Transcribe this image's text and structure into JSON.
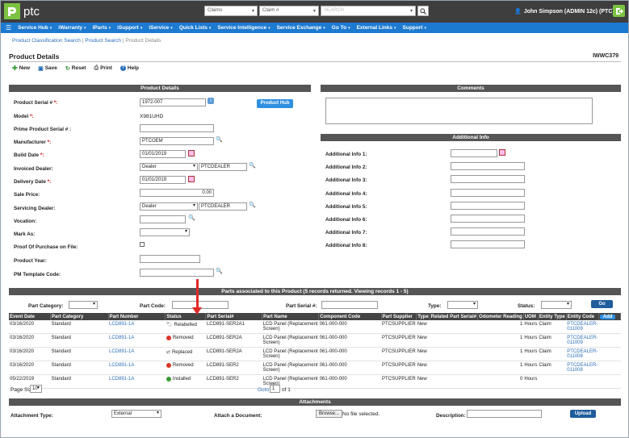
{
  "app": {
    "logo_text": "ptc"
  },
  "search": {
    "type_value": "Claims",
    "field_value": "Claim #",
    "placeholder": "SEARCH"
  },
  "user": {
    "name": "John Simpson (ADMIN 12c) (PTC)"
  },
  "nav": {
    "items": [
      "Service Hub",
      "iWarranty",
      "iParts",
      "iSupport",
      "iService",
      "Quick Lists",
      "Service Intelligence",
      "Service Exchange",
      "Go To",
      "External Links",
      "Support"
    ]
  },
  "breadcrumb": {
    "items": [
      "Product Classification Search",
      "Product Search",
      "Product Details"
    ]
  },
  "page": {
    "title": "Product Details",
    "code": "IWWC379"
  },
  "toolbar": {
    "new": "New",
    "save": "Save",
    "reset": "Reset",
    "print": "Print",
    "help": "Help"
  },
  "product_details": {
    "heading": "Product Details",
    "hub_button": "Product Hub",
    "labels": {
      "serial": "Product Serial # ",
      "model": "Model ",
      "prime_serial": "Prime Product Serial # :",
      "manufacturer": "Manufacturer ",
      "build_date": "Build Date ",
      "invoiced_dealer": "Invoiced Dealer:",
      "delivery_date": "Delivery Date ",
      "sale_price": "Sale Price:",
      "servicing_dealer": "Servicing Dealer:",
      "vocation": "Vocation:",
      "mark_as": "Mark As:",
      "proof_purchase": "Proof Of Purchase on File:",
      "product_year": "Product Year:",
      "pm_template": "PM Template Code:"
    },
    "req_suffix_colon": "*:",
    "req_suffix": "*:",
    "values": {
      "serial": "1972-007",
      "model": "X981UHD",
      "prime_serial": "",
      "manufacturer": "PTCOEM",
      "build_date": "01/01/2019",
      "invoiced_dealer_type": "Dealer",
      "invoiced_dealer": "PTCDEALER",
      "delivery_date": "01/01/2019",
      "sale_price": "0.00",
      "servicing_dealer_type": "Dealer",
      "servicing_dealer": "PTCDEALER",
      "vocation": "",
      "mark_as": "",
      "product_year": "",
      "pm_template": ""
    }
  },
  "comments": {
    "heading": "Comments"
  },
  "additional_info": {
    "heading": "Additional Info",
    "labels": [
      "Additional Info 1:",
      "Additional Info 2:",
      "Additional Info 3:",
      "Additional Info 4:",
      "Additional Info 5:",
      "Additional Info 6:",
      "Additional Info 7:",
      "Additional Info 8:"
    ]
  },
  "parts": {
    "heading": "Parts associated to this Product (5 records returned. Viewing records 1 - 5)",
    "filters": {
      "category": "Part Category:",
      "code": "Part Code:",
      "serial": "Part Serial #:",
      "type": "Type:",
      "status": "Status:",
      "go": "Go"
    },
    "columns": [
      "Event Date",
      "Part Category",
      "Part Number",
      "Status",
      "Part Serial#",
      "Part Name",
      "Component Code",
      "Part Supplier",
      "Type",
      "Related Part Serial#",
      "Odometer Reading",
      "UOM",
      "Entity Type",
      "Entity Code"
    ],
    "add_button": "Add",
    "rows": [
      {
        "date": "03/16/2020",
        "category": "Standard",
        "number": "LCD891-1A",
        "status": "Relabelled",
        "serial": "LCD891-SER2A1",
        "name": "LCD Panel (Replacement Screen)",
        "component": "061-000-000",
        "supplier": "PTCSUPPLIER",
        "type": "New",
        "related": "",
        "odometer": "1",
        "uom": "Hours",
        "entity_type": "Claim",
        "entity_code": "PTCDEALER-011009"
      },
      {
        "date": "03/16/2020",
        "category": "Standard",
        "number": "LCD891-1A",
        "status": "Removed",
        "serial": "LCD891-SER2A",
        "name": "LCD Panel (Replacement Screen)",
        "component": "061-000-000",
        "supplier": "PTCSUPPLIER",
        "type": "New",
        "related": "",
        "odometer": "1",
        "uom": "Hours",
        "entity_type": "Claim",
        "entity_code": "PTCDEALER-011009"
      },
      {
        "date": "03/16/2020",
        "category": "Standard",
        "number": "LCD891-1A",
        "status": "Replaced",
        "serial": "LCD891-SER2A",
        "name": "LCD Panel (Replacement Screen)",
        "component": "061-000-000",
        "supplier": "PTCSUPPLIER",
        "type": "New",
        "related": "",
        "odometer": "1",
        "uom": "Hours",
        "entity_type": "Claim",
        "entity_code": "PTCDEALER-011008"
      },
      {
        "date": "03/16/2020",
        "category": "Standard",
        "number": "LCD891-1A",
        "status": "Removed",
        "serial": "LCD891-SER2",
        "name": "LCD Panel (Replacement Screen)",
        "component": "061-000-000",
        "supplier": "PTCSUPPLIER",
        "type": "New",
        "related": "",
        "odometer": "1",
        "uom": "Hours",
        "entity_type": "Claim",
        "entity_code": "PTCDEALER-011008"
      },
      {
        "date": "05/22/2019",
        "category": "Standard",
        "number": "LCD891-1A",
        "status": "Installed",
        "serial": "LCD891-SER2",
        "name": "LCD Panel (Replacement Screen)",
        "component": "061-000-000",
        "supplier": "PTCSUPPLIER",
        "type": "New",
        "related": "",
        "odometer": "0",
        "uom": "Hours",
        "entity_type": "",
        "entity_code": ""
      }
    ],
    "page_size_label": "Page Size",
    "page_size": "10",
    "goto_label": "Goto:",
    "goto_value": "1",
    "of_label": "of 1"
  },
  "attachments": {
    "heading": "Attachments",
    "type_label": "Attachment Type:",
    "type_value": "External",
    "doc_label": "Attach a Document:",
    "browse": "Browse...",
    "no_file": "No file selected.",
    "desc_label": "Description:",
    "upload": "Upload"
  },
  "colors": {
    "nav": "#1d7ad1",
    "brand_green": "#7cc242",
    "removed": "#d9362b",
    "installed": "#3a9b3a"
  }
}
